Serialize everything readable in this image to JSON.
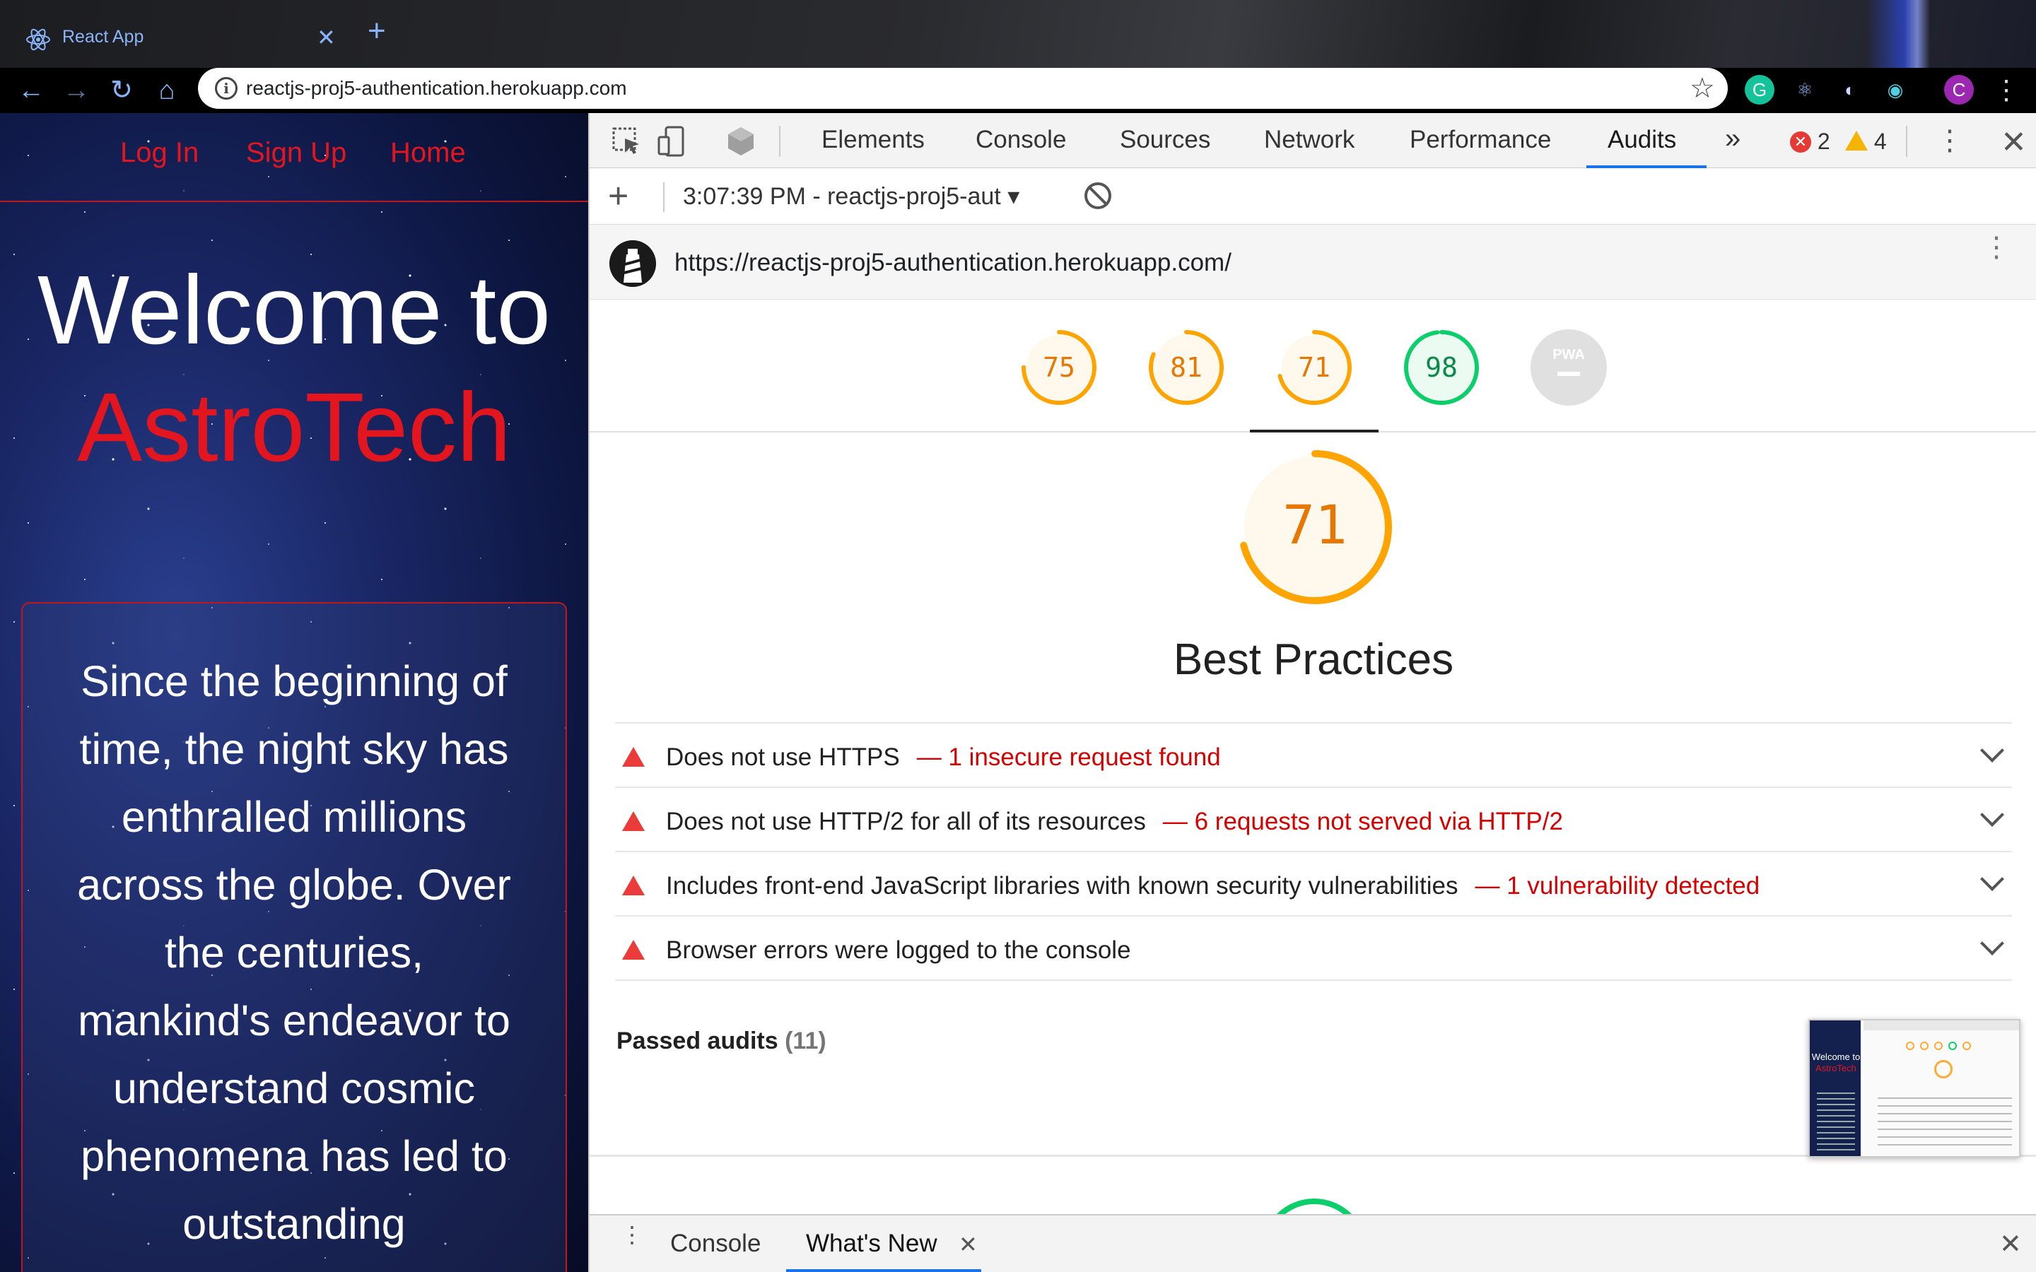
{
  "browser": {
    "tab_title": "React App",
    "tab_close": "✕",
    "new_tab": "+",
    "url": "reactjs-proj5-authentication.herokuapp.com",
    "back": "←",
    "forward": "→",
    "reload": "↻",
    "home": "⌂",
    "star": "☆",
    "extensions": [
      {
        "name": "grammarly-icon",
        "glyph": "G",
        "bg": "#15c39a",
        "color": "#fff"
      },
      {
        "name": "react-devtools-icon",
        "glyph": "⚛",
        "bg": "transparent",
        "color": "#8ab4f8"
      },
      {
        "name": "vpn-extension-icon",
        "glyph": "◐",
        "bg": "transparent",
        "color": "#cfd8ff"
      },
      {
        "name": "eye-extension-icon",
        "glyph": "◉",
        "bg": "transparent",
        "color": "#4dd0e1"
      },
      {
        "name": "profile-avatar",
        "glyph": "C",
        "bg": "#9c27b0",
        "color": "#fff"
      }
    ],
    "menu": "⋮"
  },
  "site": {
    "nav": [
      "Log In",
      "Sign Up",
      "Home"
    ],
    "welcome": "Welcome to",
    "brand": "AstroTech",
    "paragraph_lines": [
      "Since the beginning of",
      "time, the night sky has",
      "enthralled millions",
      "across the globe. Over",
      "the centuries,",
      "mankind's endeavor to",
      "understand cosmic",
      "phenomena has led to",
      "outstanding"
    ]
  },
  "devtools": {
    "tabs": [
      "Elements",
      "Console",
      "Sources",
      "Network",
      "Performance",
      "Audits"
    ],
    "active_tab": "Audits",
    "more": "»",
    "errors": "2",
    "warnings": "4",
    "close": "✕",
    "audit_select": "3:07:39 PM - reactjs-proj5-aut ▾",
    "report_url": "https://reactjs-proj5-authentication.herokuapp.com/",
    "gauges": [
      {
        "score": 75,
        "color": "#ffa400",
        "fill": "#fff8ed"
      },
      {
        "score": 81,
        "color": "#ffa400",
        "fill": "#fff8ed"
      },
      {
        "score": 71,
        "color": "#ffa400",
        "fill": "#fff8ed"
      },
      {
        "score": 98,
        "color": "#0cce6b",
        "fill": "#ecfbf2"
      }
    ],
    "pwa_label": "PWA",
    "pwa_dash": "—",
    "selected_score": "71",
    "selected_fraction": 0.71,
    "category_title": "Best Practices",
    "audits": [
      {
        "title": "Does not use HTTPS",
        "detail": "— 1 insecure request found"
      },
      {
        "title": "Does not use HTTP/2 for all of its resources",
        "detail": "— 6 requests not served via HTTP/2"
      },
      {
        "title": "Includes front-end JavaScript libraries with known security vulnerabilities",
        "detail": "— 1 vulnerability detected"
      },
      {
        "title": "Browser errors were logged to the console",
        "detail": ""
      }
    ],
    "passed_label": "Passed audits",
    "passed_count": "(11)",
    "thumbnail": {
      "welcome": "Welcome to",
      "brand": "AstroTech"
    },
    "drawer": {
      "tabs": [
        "Console",
        "What's New"
      ],
      "active": "What's New",
      "tab_close": "✕",
      "close": "✕"
    }
  }
}
